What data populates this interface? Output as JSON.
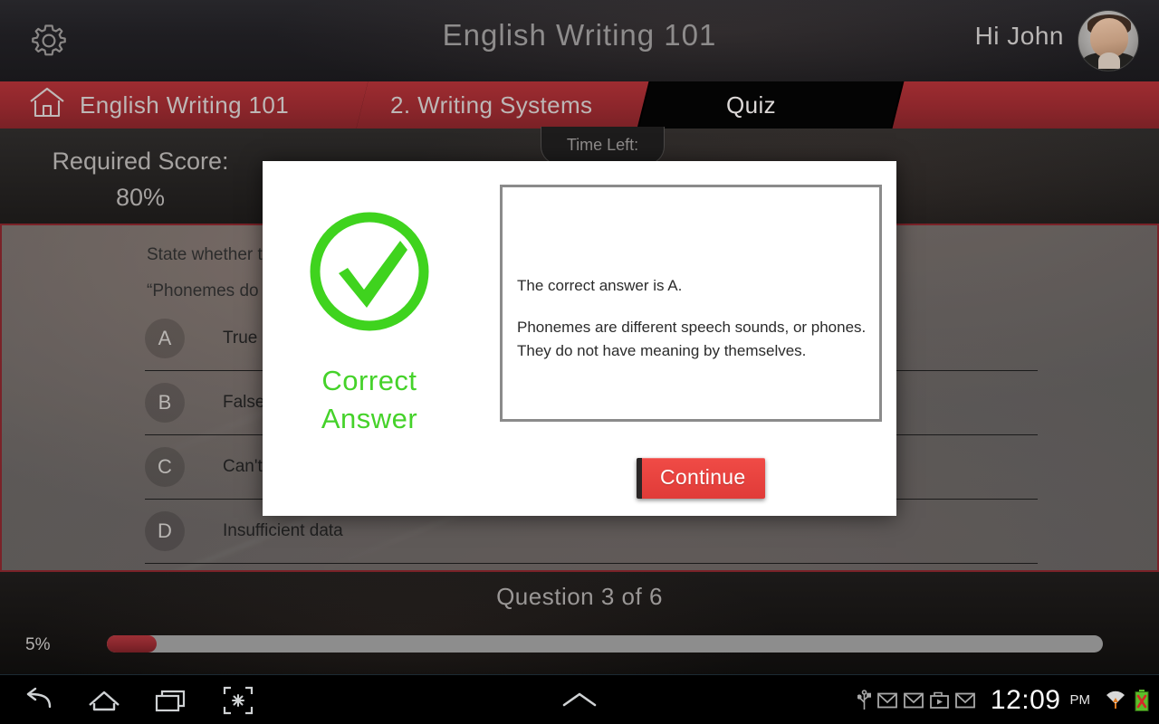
{
  "header": {
    "gear_icon": "gear-icon",
    "title": "English Writing 101",
    "greeting": "Hi John",
    "avatar_icon": "user-avatar"
  },
  "breadcrumb": {
    "home_icon": "home-icon",
    "items": [
      {
        "label": "English Writing 101",
        "active": false
      },
      {
        "label": "2. Writing Systems",
        "active": false
      },
      {
        "label": "Quiz",
        "active": true
      }
    ]
  },
  "info_strip": {
    "required_score_label": "Required Score:",
    "required_score_value": "80%",
    "time_left_label": "Time Left:"
  },
  "quiz": {
    "question_statement": "State whether the",
    "question_quote": "“Phonemes do no",
    "options": [
      {
        "letter": "A",
        "text": "True"
      },
      {
        "letter": "B",
        "text": "False"
      },
      {
        "letter": "C",
        "text": "Can't say"
      },
      {
        "letter": "D",
        "text": "Insufficient data"
      }
    ]
  },
  "footer": {
    "question_counter": "Question 3 of 6",
    "progress_percent_label": "5%",
    "progress_percent_value": 5
  },
  "modal": {
    "status_icon": "check-circle-icon",
    "verdict_line1": "Correct",
    "verdict_line2": "Answer",
    "explanation_line1": "The correct answer is A.",
    "explanation_line2": "Phonemes are different speech sounds, or phones. They do not have meaning by themselves.",
    "continue_label": "Continue"
  },
  "system_bar": {
    "back_icon": "back-icon",
    "home_icon": "home-icon",
    "recents_icon": "recent-apps-icon",
    "screenshot_icon": "screenshot-icon",
    "expand_icon": "chevron-up-icon",
    "usb_icon": "usb-icon",
    "mail_icon_1": "mail-icon",
    "mail_icon_2": "mail-icon",
    "media_icon": "media-icon",
    "mail_icon_3": "mail-icon",
    "time": "12:09",
    "am_pm": "PM",
    "wifi_icon": "wifi-icon",
    "battery_icon": "battery-error-icon"
  },
  "colors": {
    "accent_red": "#8c262b",
    "correct_green": "#45d22a",
    "continue_red": "#e8433f"
  }
}
